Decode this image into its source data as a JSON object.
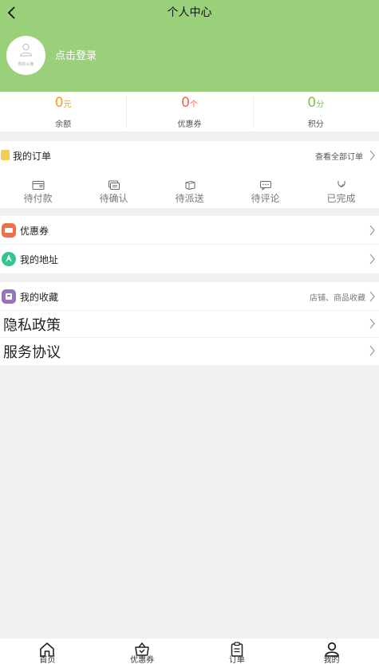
{
  "header": {
    "title": "个人中心",
    "avatar_caption": "我的头像",
    "login_label": "点击登录",
    "bg_color": "#9bd07a"
  },
  "stats": [
    {
      "value": "0",
      "unit": "元",
      "label": "余额",
      "color": "#f0a020"
    },
    {
      "value": "0",
      "unit": "个",
      "label": "优惠券",
      "color": "#ee6644"
    },
    {
      "value": "0",
      "unit": "分",
      "label": "积分",
      "color": "#7cc24a"
    }
  ],
  "orders": {
    "title": "我的订单",
    "view_all": "查看全部订单",
    "items": [
      {
        "label": "待付款",
        "icon": "wallet-icon"
      },
      {
        "label": "待确认",
        "icon": "confirm-icon"
      },
      {
        "label": "待派送",
        "icon": "delivery-icon"
      },
      {
        "label": "待评论",
        "icon": "comment-icon"
      },
      {
        "label": "已完成",
        "icon": "completed-icon"
      }
    ]
  },
  "menu1": {
    "coupons": {
      "label": "优惠券",
      "color": "#ee7048"
    },
    "address": {
      "label": "我的地址",
      "color": "#35c48a"
    }
  },
  "menu2": {
    "favorites": {
      "label": "我的收藏",
      "right": "店铺、商品收藏",
      "color": "#9a73b8"
    },
    "privacy": {
      "label": "隐私政策"
    },
    "terms": {
      "label": "服务协议"
    }
  },
  "tabbar": [
    {
      "label": "首页",
      "icon": "home-icon"
    },
    {
      "label": "优惠券",
      "icon": "basket-icon"
    },
    {
      "label": "订单",
      "icon": "clipboard-icon"
    },
    {
      "label": "我的",
      "icon": "user-icon"
    }
  ]
}
